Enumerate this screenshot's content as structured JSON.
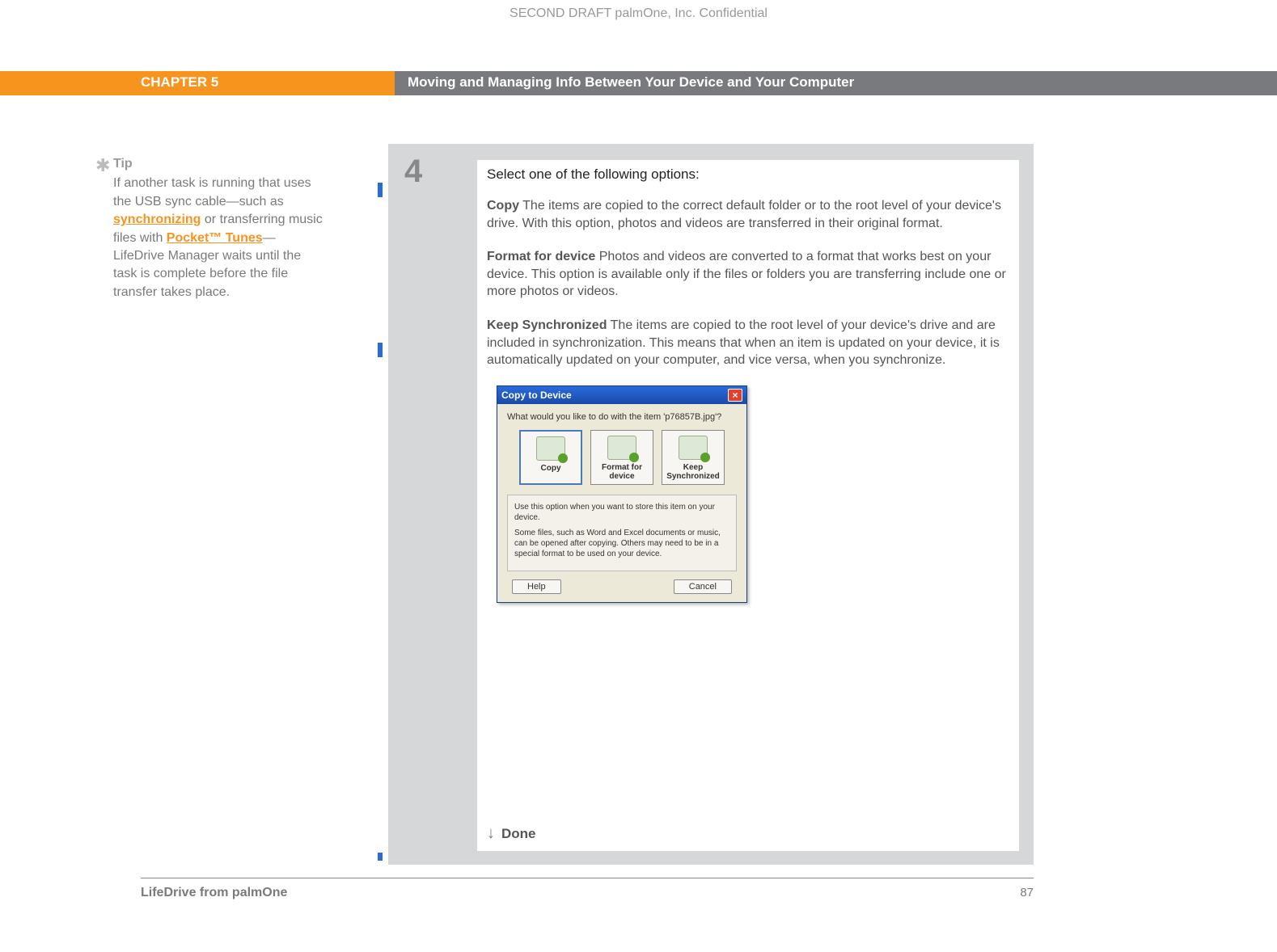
{
  "confidential": "SECOND DRAFT palmOne, Inc.  Confidential",
  "header": {
    "chapter": "CHAPTER 5",
    "title": "Moving and Managing Info Between Your Device and Your Computer"
  },
  "tip": {
    "label": "Tip",
    "t1": "If another task is running that uses the USB sync cable—such as ",
    "link1": "synchronizing",
    "t2": " or transferring music files with ",
    "link2": "Pocket™ Tunes",
    "t3": "—LifeDrive Manager waits until the task is complete before the file transfer takes place."
  },
  "step": {
    "number": "4",
    "instruction": "Select one of the following options:",
    "copy_label": "Copy",
    "copy_text": "   The items are copied to the correct default folder or to the root level of your device's drive. With this option, photos and videos are transferred in their original format.",
    "format_label": "Format for device",
    "format_text": "   Photos and videos are converted to a format that works best on your device. This option is available only if the files or folders you are transferring include one or more photos or videos.",
    "keep_label": "Keep Synchronized",
    "keep_text": "   The items are copied to the root level of your device's drive and are included in synchronization. This means that when an item is updated on your device, it is automatically updated on your computer, and vice versa, when you synchronize.",
    "done": "Done"
  },
  "dialog": {
    "title": "Copy to Device",
    "question": "What would you like to do with the item 'p76857B.jpg'?",
    "opt_copy": "Copy",
    "opt_format1": "Format for",
    "opt_format2": "device",
    "opt_keep1": "Keep",
    "opt_keep2": "Synchronized",
    "hint1": "Use this option when you want to store this item on your device.",
    "hint2": "Some files, such as Word and Excel documents or music, can be opened after copying. Others may need to be in a special format to be used on your device.",
    "help": "Help",
    "cancel": "Cancel"
  },
  "footer": {
    "left": "LifeDrive from palmOne",
    "page": "87"
  }
}
